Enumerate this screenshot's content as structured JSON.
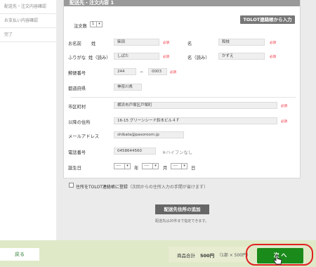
{
  "sidebar": {
    "items": [
      {
        "label": "配送先・注文内容確認"
      },
      {
        "label": "お支払い内容確認"
      },
      {
        "label": "完了"
      }
    ]
  },
  "panel": {
    "title": "配送先・注文内容 1"
  },
  "tolot_button": {
    "label": "TOLOT連絡帳から入力"
  },
  "order_qty": {
    "label": "注文数",
    "value": "1"
  },
  "form": {
    "required_mark": "必須",
    "name": {
      "label": "お名前",
      "last_label": "姓",
      "last_value": "柴田",
      "first_label": "名",
      "first_value": "和枝"
    },
    "kana": {
      "label": "ふりがな",
      "last_label": "姓（読み）",
      "last_value": "しばた",
      "first_label": "名（読み）",
      "first_value": "かずえ"
    },
    "postal": {
      "label": "郵便番号",
      "part1": "244",
      "dash": "−",
      "part2": "0003"
    },
    "prefecture": {
      "label": "都道府県",
      "value": "神奈川県"
    },
    "city": {
      "label": "市区町村",
      "value": "横浜市戸塚区戸塚町"
    },
    "address": {
      "label": "以降の住所",
      "value": "16-15 グリーンシード鈴木ビル４Ｆ"
    },
    "email": {
      "label": "メールアドレス",
      "value": "shibata@pasoroom.jp"
    },
    "phone": {
      "label": "電話番号",
      "value": "0458644560",
      "note": "※ハイフンなし"
    },
    "birthday": {
      "label": "誕生日",
      "year_value": "----",
      "year_unit": "年",
      "month_value": "----",
      "month_unit": "月",
      "day_value": "----",
      "day_unit": "日"
    },
    "register": {
      "label": "住所をTOLOT連絡帳に登録",
      "note": "（次回からの住所入力の手間が省けます）"
    }
  },
  "add_address": {
    "label": "配送先住所の追加",
    "note": "配送先は20件まで指定できます。"
  },
  "footer": {
    "back_label": "戻る",
    "total_label": "商品合計",
    "total_value": "500円",
    "total_detail": "（1部 × 500円）",
    "next_label": "次 へ"
  },
  "colors": {
    "next_button": "#1a8a1a",
    "footer_bg": "#dfe9c8",
    "highlight_outline": "#e02020",
    "required": "#ee2233"
  }
}
